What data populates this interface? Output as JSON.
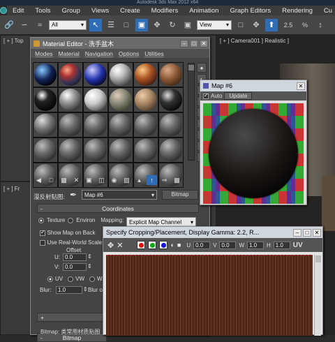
{
  "app": {
    "title": "Autodesk 3ds Max 2012 x64"
  },
  "menubar": {
    "items": [
      "Edit",
      "Tools",
      "Group",
      "Views",
      "Create",
      "Modifiers",
      "Animation",
      "Graph Editors",
      "Rendering",
      "Cu"
    ]
  },
  "toolbar": {
    "filter_value": "All",
    "refcoord_value": "View",
    "angle_value": "2.5",
    "percent_value": "%"
  },
  "viewports": {
    "top_label": "[ + ] Top",
    "front_label": "[ + ] Fr",
    "camera_label": "[ + ] Camera001 ] Realistic ]"
  },
  "material_editor": {
    "title": "Material Editor - 洗手盆木",
    "menu": [
      "Modes",
      "Material",
      "Navigation",
      "Options",
      "Utilities"
    ],
    "map_label": "漫反射贴图:",
    "map_name": "Map #6",
    "map_type": "Bitmap",
    "coordinates": {
      "header": "Coordinates",
      "texture_label": "Texture",
      "environ_label": "Environ",
      "mapping_label": "Mapping:",
      "mapping_value": "Explicit Map Channel",
      "show_map_label": "Show Map on Back",
      "real_world_label": "Use Real-World Scale",
      "offset_label": "Offset",
      "u_label": "U:",
      "v_label": "V:",
      "u_value": "0.0",
      "v_value": "0.0",
      "uv_label": "UV",
      "vw_label": "VW",
      "wu_label": "WU",
      "blur_label": "Blur:",
      "blur_value": "1.0",
      "blur_offset_label": "Blur o"
    },
    "bottom_header": "Bitmap",
    "bitmap_label": "Bitmap: 类常用材质贴图"
  },
  "map6": {
    "title": "Map #6",
    "auto_label": "Auto",
    "update_label": "Update"
  },
  "cropping": {
    "title": "Specify Cropping/Placement, Display Gamma: 2.2, R...",
    "u_label": "U",
    "u_value": "0.0",
    "v_label": "V",
    "v_value": "0.0",
    "w_label": "W",
    "w_value": "1.0",
    "h_label": "H",
    "h_value": "1.0",
    "uv_label": "UV"
  },
  "colors": {
    "accent": "#2f6db5",
    "wood": "#5a2e1c"
  }
}
